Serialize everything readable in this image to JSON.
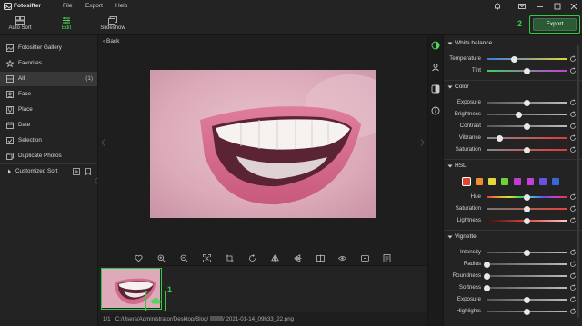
{
  "app": {
    "title": "Fotosifter"
  },
  "menu": [
    "File",
    "Export",
    "Help"
  ],
  "toolbar": {
    "auto_sort": "Auto Sort",
    "edit": "Edit",
    "slideshow": "Slideshow",
    "export": "Export"
  },
  "markers": {
    "one": "1",
    "two": "2"
  },
  "sidebar": {
    "items": [
      {
        "label": "Fotosifter Gallery",
        "icon": "gallery-icon"
      },
      {
        "label": "Favorites",
        "icon": "star-icon"
      },
      {
        "label": "All",
        "count": "(1)",
        "icon": "all-photos-icon"
      },
      {
        "label": "Face",
        "icon": "face-icon"
      },
      {
        "label": "Place",
        "icon": "place-icon"
      },
      {
        "label": "Date",
        "icon": "calendar-icon"
      },
      {
        "label": "Selection",
        "icon": "selection-icon"
      },
      {
        "label": "Duplicate Photos",
        "icon": "duplicate-icon"
      }
    ],
    "customized_sort": "Customized Sort"
  },
  "viewer": {
    "back": "Back"
  },
  "status": {
    "counter": "1/1",
    "path": "C:/Users/Administrator/Desktop/Blog/",
    "filename": "2021-01-14_09h33_22.png"
  },
  "panel": {
    "white_balance": {
      "title": "White balance",
      "rows": [
        {
          "label": "Temperature",
          "value": 0.35
        },
        {
          "label": "Tint",
          "value": 0.5
        }
      ]
    },
    "color": {
      "title": "Color",
      "rows": [
        {
          "label": "Exposure",
          "value": 0.5
        },
        {
          "label": "Brightness",
          "value": 0.4
        },
        {
          "label": "Contrast",
          "value": 0.5
        },
        {
          "label": "Vibrance",
          "value": 0.17
        },
        {
          "label": "Saturation",
          "value": 0.5
        }
      ]
    },
    "hsl": {
      "title": "HSL",
      "swatches": [
        "#e2452f",
        "#f0902a",
        "#e2d83a",
        "#6fd13a",
        "#c03bd0",
        "#c43fd6",
        "#6a4fe0",
        "#3b66d8"
      ],
      "rows": [
        {
          "label": "Hue",
          "value": 0.5
        },
        {
          "label": "Saturation",
          "value": 0.5
        },
        {
          "label": "Lightness",
          "value": 0.5
        }
      ]
    },
    "vignette": {
      "title": "Vignette",
      "rows": [
        {
          "label": "Intensity",
          "value": 0.5
        },
        {
          "label": "Radius",
          "value": 0.0
        },
        {
          "label": "Roundness",
          "value": 0.0
        },
        {
          "label": "Softness",
          "value": 0.0
        },
        {
          "label": "Exposure",
          "value": 0.5
        },
        {
          "label": "Highlights",
          "value": 0.5
        }
      ]
    }
  },
  "colors": {
    "accent": "#2ecc4a",
    "export_bg": "#2b5a34"
  }
}
